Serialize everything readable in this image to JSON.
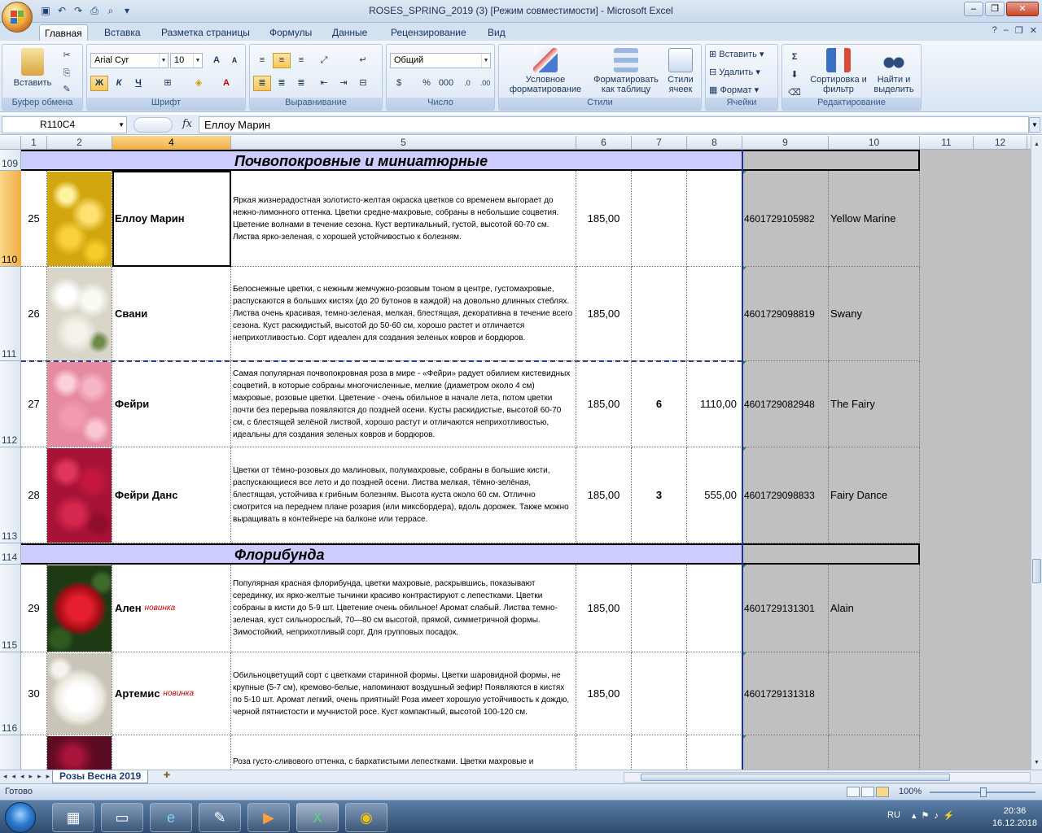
{
  "window": {
    "title": "ROSES_SPRING_2019 (3)  [Режим совместимости] - Microsoft Excel",
    "controls": [
      "–",
      "❐",
      "✕"
    ]
  },
  "ribbon_tabs": [
    "Главная",
    "Вставка",
    "Разметка страницы",
    "Формулы",
    "Данные",
    "Рецензирование",
    "Вид"
  ],
  "ribbon": {
    "clipboard": {
      "paste": "Вставить",
      "label": "Буфер обмена"
    },
    "font": {
      "name": "Arial Cyr",
      "size": "10",
      "bold": "Ж",
      "italic": "К",
      "underline": "Ч",
      "label": "Шрифт"
    },
    "align": {
      "label": "Выравнивание"
    },
    "number": {
      "format": "Общий",
      "percent": "%",
      "thousands": "000",
      "label": "Число"
    },
    "styles": {
      "cond": "Условное форматирование",
      "table": "Форматировать как таблицу",
      "cell": "Стили ячеек",
      "label": "Стили"
    },
    "cells": {
      "insert": "Вставить",
      "delete": "Удалить",
      "format": "Формат",
      "label": "Ячейки"
    },
    "edit": {
      "sigma": "Σ",
      "sort": "Сортировка и фильтр",
      "find": "Найти и выделить",
      "label": "Редактирование"
    }
  },
  "formula": {
    "namebox": "R110C4",
    "fx": "fx",
    "content": "Еллоу Марин"
  },
  "columns": [
    "1",
    "2",
    "4",
    "5",
    "6",
    "7",
    "8",
    "9",
    "10",
    "11",
    "12"
  ],
  "sections": [
    {
      "row": "109",
      "title": "Почвопокровные и миниатюрные"
    },
    {
      "row": "114",
      "title": "Флорибунда"
    }
  ],
  "rows": [
    {
      "rownum": "110",
      "n": "25",
      "name": "Еллоу Марин",
      "novelty": "",
      "desc": "Яркая жизнерадостная золотисто-желтая окраска цветков со временем выгорает до нежно-лимонного оттенка. Цветки средне-махровые, собраны в небольшие соцветия. Цветение волнами в течение сезона. Куст вертикальный, густой, высотой 60-70 см. Листва ярко-зеленая, с хорошей устойчивостью к болезням.",
      "price": "185,00",
      "qty": "",
      "sum": "",
      "code": "4601729105982",
      "eng": "Yellow Marine",
      "color": "#e8c21e"
    },
    {
      "rownum": "111",
      "n": "26",
      "name": "Свани",
      "novelty": "",
      "desc": "Белоснежные цветки, с нежным жемчужно-розовым тоном в центре, густомахровые, распускаются в больших кистях (до 20 бутонов в каждой) на довольно длинных стеблях. Листва очень красивая, темно-зеленая, мелкая, блестящая, декоративна в течение всего сезона. Куст раскидистый, высотой до 50-60 см, хорошо растет и отличается неприхотливостью. Сорт идеален для создания зеленых ковров и бордюров.",
      "price": "185,00",
      "qty": "",
      "sum": "",
      "code": "4601729098819",
      "eng": "Swany",
      "color": "#ecece4"
    },
    {
      "rownum": "112",
      "n": "27",
      "name": "Фейри",
      "novelty": "",
      "desc": "Самая популярная почвопокровная роза в мире - «Фейри» радует обилием кистевидных соцветий, в которые собраны многочисленные, мелкие (диаметром около 4 см) махровые, розовые цветки. Цветение - очень обильное в начале лета, потом цветки почти без перерыва появляются до поздней осени. Кусты раскидистые, высотой 60-70 см, с блестящей зелёной листвой, хорошо растут и отличаются неприхотливостью, идеальны для создания зеленых ковров и бордюров.",
      "price": "185,00",
      "qty": "6",
      "sum": "1110,00",
      "code": "4601729082948",
      "eng": "The Fairy",
      "color": "#f1a8bb"
    },
    {
      "rownum": "113",
      "n": "28",
      "name": "Фейри Данс",
      "novelty": "",
      "desc": "Цветки от тёмно-розовых до малиновых, полумахровые, собраны в большие кисти, распускающиеся все лето и до поздней осени. Листва мелкая, тёмно-зелёная, блестящая, устойчива к грибным болезням. Высота куста около 60 см. Отлично смотрится на переднем плане розария (или миксбордера), вдоль дорожек. Также можно выращивать в контейнере на балконе или террасе.",
      "price": "185,00",
      "qty": "3",
      "sum": "555,00",
      "code": "4601729098833",
      "eng": "Fairy Dance",
      "color": "#b8163a"
    },
    {
      "rownum": "115",
      "n": "29",
      "name": "Ален",
      "novelty": "новинка",
      "desc": "Популярная красная флорибунда, цветки махровые, раскрывшись, показывают серединку, их ярко-желтые тычинки красиво контрастируют с лепестками. Цветки собраны в кисти до 5-9 шт. Цветение очень обильное! Аромат слабый. Листва темно-зеленая, куст сильнорослый, 70—80 см высотой, прямой, симметричной формы. Зимостойкий, неприхотливый сорт. Для групповых посадок.",
      "price": "185,00",
      "qty": "",
      "sum": "",
      "code": "4601729131301",
      "eng": "Alain",
      "color": "#b50d16"
    },
    {
      "rownum": "116",
      "n": "30",
      "name": "Артемис",
      "novelty": "новинка",
      "desc": "Обильноцветущий сорт с цветками старинной формы. Цветки шаровидной формы, не крупные (5-7 см), кремово-белые, напоминают воздушный зефир! Появляются в кистях по 5-10 шт. Аромат легкий, очень приятный! Роза имеет хорошую устойчивость к дождю, черной пятнистости и мучнистой росе. Куст компактный, высотой 100-120 см.",
      "price": "185,00",
      "qty": "",
      "sum": "",
      "code": "4601729131318",
      "eng": "",
      "color": "#f2f0ea"
    },
    {
      "rownum": "",
      "n": "",
      "name": "",
      "novelty": "",
      "desc": "Роза густо-сливового оттенка, с бархатистыми лепестками. Цветки махровые и",
      "price": "",
      "qty": "",
      "sum": "",
      "code": "",
      "eng": "",
      "color": "#8b1030"
    }
  ],
  "sheet_tab": "Розы Весна 2019",
  "status": {
    "ready": "Готово",
    "zoom": "100%"
  },
  "tray": {
    "lang": "RU",
    "time": "20:36",
    "date": "16.12.2018"
  }
}
